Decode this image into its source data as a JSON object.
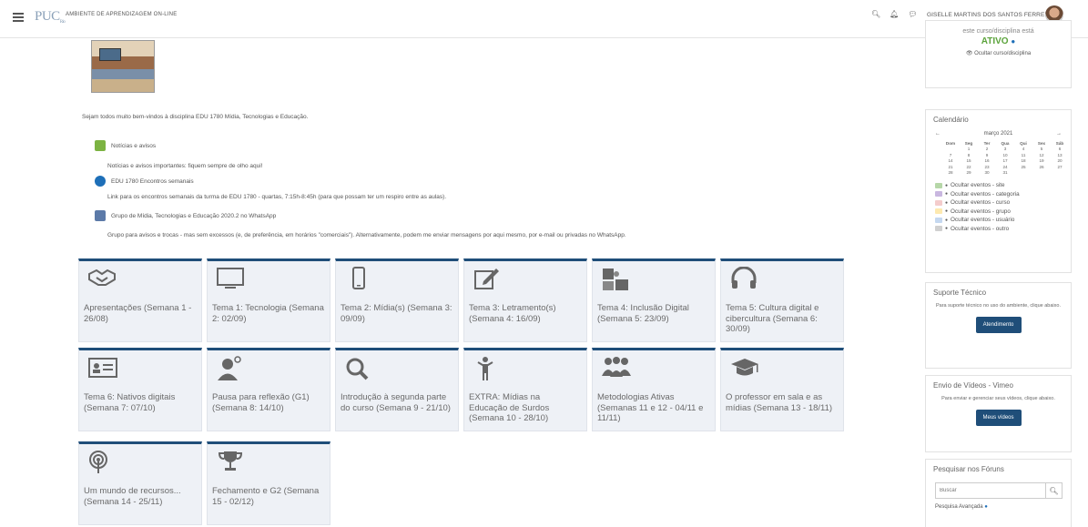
{
  "topbar": {
    "brand": "PUC",
    "brand_sub": "Rio",
    "site_name": "AMBIENTE DE APRENDIZAGEM ON-LINE",
    "user_name": "GISELLE MARTINS DOS SANTOS FERREIRA"
  },
  "main": {
    "welcome": "Sejam todos muito bem-vindos à disciplina EDU 1780 Mídia, Tecnologias e Educação.",
    "activities": [
      {
        "label": "Notícias e avisos",
        "description": "Notícias e avisos importantes: fiquem sempre de olho aqui!",
        "icon": "forum-icon",
        "color": "#7cb342"
      },
      {
        "label": "EDU 1780 Encontros semanais",
        "description": "Link para os encontros semanais da turma de EDU 1780 - quartas, 7:15h-8:45h (para que possam ter um respiro entre as aulas).",
        "icon": "url-icon",
        "color": "#1e6fb8"
      },
      {
        "label": "Grupo de Mídia, Tecnologias e Educação 2020.2 no WhatsApp",
        "description": "Grupo para avisos e trocas - mas sem excessos (e, de preferência, em horários \"comerciais\"). Alternativamente, podem me enviar mensagens por aqui mesmo, por e-mail ou privadas no WhatsApp.",
        "icon": "file-icon",
        "color": "#5c7aa8"
      }
    ]
  },
  "tiles": [
    {
      "title": "Apresentações (Semana 1 - 26/08)",
      "icon": "handshake-icon"
    },
    {
      "title": "Tema 1: Tecnologia (Semana 2: 02/09)",
      "icon": "monitor-icon"
    },
    {
      "title": "Tema 2: Mídia(s) (Semana 3: 09/09)",
      "icon": "mobile-icon"
    },
    {
      "title": "Tema 3: Letramento(s) (Semana 4: 16/09)",
      "icon": "edit-icon"
    },
    {
      "title": "Tema 4: Inclusão Digital (Semana 5: 23/09)",
      "icon": "puzzle-icon"
    },
    {
      "title": "Tema 5: Cultura digital e cibercultura (Semana 6: 30/09)",
      "icon": "headphones-icon"
    },
    {
      "title": "Tema 6: Nativos digitais (Semana 7: 07/10)",
      "icon": "id-card-icon"
    },
    {
      "title": "Pausa para reflexão (G1) (Semana 8: 14/10)",
      "icon": "thinking-user-icon"
    },
    {
      "title": "Introdução à segunda parte do curso (Semana 9 - 21/10)",
      "icon": "search-icon"
    },
    {
      "title": "EXTRA: Mídias na Educação de Surdos (Semana 10 - 28/10)",
      "icon": "child-icon"
    },
    {
      "title": "Metodologias Ativas (Semanas 11 e 12 - 04/11 e 11/11)",
      "icon": "group-icon"
    },
    {
      "title": "O professor em sala e as mídias (Semana 13 - 18/11)",
      "icon": "graduation-cap-icon"
    },
    {
      "title": "Um mundo de recursos... (Semana 14 - 25/11)",
      "icon": "podcast-icon"
    },
    {
      "title": "Fechamento e G2 (Semana 15 - 02/12)",
      "icon": "trophy-icon"
    }
  ],
  "sidebar": {
    "status_text": "este curso/disciplina está",
    "status": "ATIVO",
    "hide_course": "Ocultar curso/disciplina",
    "calendar_title": "Calendário",
    "month": "março 2021",
    "weekdays": [
      "Dom",
      "Seg",
      "Ter",
      "Qua",
      "Qui",
      "Sex",
      "Sáb"
    ],
    "weeks": [
      [
        "",
        "1",
        "2",
        "3",
        "4",
        "5",
        "6"
      ],
      [
        "7",
        "8",
        "9",
        "10",
        "11",
        "12",
        "13"
      ],
      [
        "14",
        "15",
        "16",
        "17",
        "18",
        "19",
        "20"
      ],
      [
        "21",
        "22",
        "23",
        "24",
        "25",
        "26",
        "27"
      ],
      [
        "28",
        "29",
        "30",
        "31",
        "",
        "",
        ""
      ]
    ],
    "event_filters": [
      {
        "label": "Ocultar eventos - site",
        "color": "#b6d7a8"
      },
      {
        "label": "Ocultar eventos - categoria",
        "color": "#c9b7e0"
      },
      {
        "label": "Ocultar eventos - curso",
        "color": "#f4cccc"
      },
      {
        "label": "Ocultar eventos - grupo",
        "color": "#fde9b0"
      },
      {
        "label": "Ocultar eventos - usuário",
        "color": "#c5d8f0"
      },
      {
        "label": "Ocultar eventos - outro",
        "color": "#d0d0d0"
      }
    ],
    "support_title": "Suporte Técnico",
    "support_text": "Para suporte técnico no uso do ambiente, clique abaixo.",
    "support_button": "Atendimento",
    "video_title": "Envio de Vídeos - Vimeo",
    "video_text": "Para enviar e gerenciar seus vídeos, clique abaixo.",
    "video_button": "Meus vídeos",
    "forum_title": "Pesquisar nos Fóruns",
    "search_placeholder": "Buscar",
    "advanced_search": "Pesquisa Avançada"
  }
}
